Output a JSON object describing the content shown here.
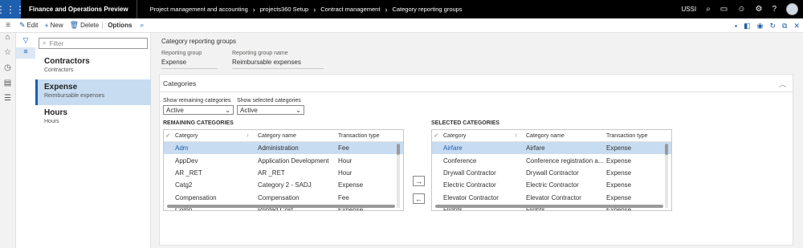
{
  "topbar": {
    "app_title": "Finance and Operations Preview",
    "breadcrumbs": [
      "Project management and accounting",
      "projects360 Setup",
      "Contract management",
      "Category reporting groups"
    ],
    "company": "USSI"
  },
  "actions": {
    "edit": "Edit",
    "new": "New",
    "delete": "Delete",
    "options": "Options"
  },
  "list": {
    "filter_placeholder": "Filter",
    "items": [
      {
        "title": "Contractors",
        "subtitle": "Contractors"
      },
      {
        "title": "Expense",
        "subtitle": "Reimbursable expenses"
      },
      {
        "title": "Hours",
        "subtitle": "Hours"
      }
    ]
  },
  "page": {
    "title": "Category reporting groups",
    "reporting_group_label": "Reporting group",
    "reporting_group_value": "Expense",
    "reporting_group_name_label": "Reporting group name",
    "reporting_group_name_value": "Reimbursable expenses"
  },
  "categories": {
    "header": "Categories",
    "show_remaining_label": "Show remaining categories",
    "show_remaining_value": "Active",
    "show_selected_label": "Show selected categories",
    "show_selected_value": "Active",
    "remaining_title": "REMAINING CATEGORIES",
    "selected_title": "SELECTED CATEGORIES",
    "columns": {
      "category": "Category",
      "category_name": "Category name",
      "transaction_type": "Transaction type"
    },
    "remaining_rows": [
      [
        "Adm",
        "Administration",
        "Fee"
      ],
      [
        "AppDev",
        "Application Development",
        "Hour"
      ],
      [
        "AR _RET",
        "AR _RET",
        "Hour"
      ],
      [
        "Catg2",
        "Category 2 - SADJ",
        "Expense"
      ],
      [
        "Compensation",
        "Compensation",
        "Fee"
      ],
      [
        "Comp...",
        "Printed Cost...",
        "Expense"
      ]
    ],
    "selected_rows": [
      [
        "Airfare",
        "Airfare",
        "Expense"
      ],
      [
        "Conference",
        "Conference registration a...",
        "Expense"
      ],
      [
        "Drywall Contractor",
        "Drywall Contractor",
        "Expense"
      ],
      [
        "Electric Contractor",
        "Electric Contractor",
        "Expense"
      ],
      [
        "Elevator Contractor",
        "Elevator Contractor",
        "Expense"
      ],
      [
        "Flights",
        "Flights",
        "Expense"
      ]
    ],
    "add_button": "→",
    "remove_button": "←"
  }
}
